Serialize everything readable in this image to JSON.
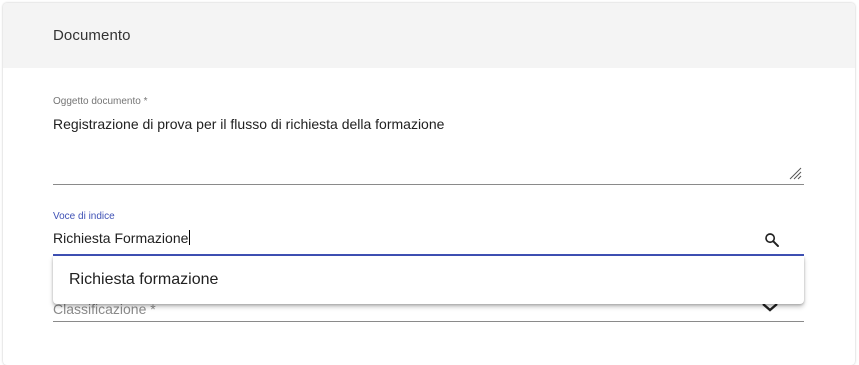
{
  "card": {
    "title": "Documento"
  },
  "oggetto": {
    "label": "Oggetto documento *",
    "value": "Registrazione di prova per il flusso di richiesta della formazione"
  },
  "voce_indice": {
    "label": "Voce di indice",
    "value": "Richiesta Formazione",
    "icon": "search-icon",
    "accent_color": "#3f51b5"
  },
  "autocomplete": {
    "options": [
      {
        "label": "Richiesta formazione"
      }
    ]
  },
  "classificazione": {
    "placeholder": "Classificazione *",
    "icon": "chevron-down-icon"
  }
}
